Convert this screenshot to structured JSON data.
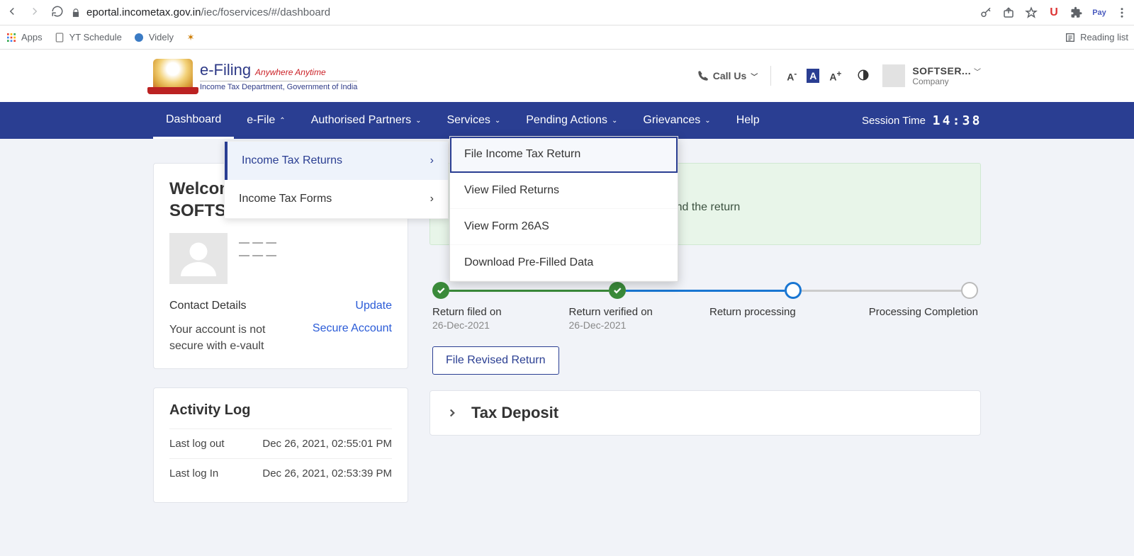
{
  "browser": {
    "url_host": "eportal.incometax.gov.in",
    "url_path": "/iec/foservices/#/dashboard",
    "bookmarks": {
      "apps": "Apps",
      "yt": "YT Schedule",
      "videly": "Videly"
    },
    "reading_list": "Reading list"
  },
  "header": {
    "brand": "e-Filing",
    "tagline": "Anywhere Anytime",
    "dept": "Income Tax Department, Government of India",
    "callus": "Call Us",
    "user_name": "SOFTSER...",
    "user_type": "Company"
  },
  "nav": {
    "items": [
      "Dashboard",
      "e-File",
      "Authorised Partners",
      "Services",
      "Pending Actions",
      "Grievances",
      "Help"
    ],
    "session_label": "Session Time",
    "session_digits": [
      "1",
      "4",
      ":",
      "3",
      "8"
    ]
  },
  "dropdown_efile": {
    "items": [
      "Income Tax Returns",
      "Income Tax Forms"
    ]
  },
  "dropdown_itr": {
    "items": [
      "File Income Tax Return",
      "View Filed Returns",
      "View Form 26AS",
      "Download Pre-Filled Data"
    ]
  },
  "profile": {
    "welcome_prefix": "Welcome B",
    "company_line": "SOFTSERV",
    "contact_label": "Contact Details",
    "update_link": "Update",
    "secure_msg": "Your account is not secure with e-vault",
    "secure_link": "Secure Account"
  },
  "activity": {
    "title": "Activity Log",
    "rows": [
      {
        "label": "Last log out",
        "value": "Dec 26, 2021, 02:55:01 PM"
      },
      {
        "label": "Last log In",
        "value": "Dec 26, 2021, 02:53:39 PM"
      }
    ]
  },
  "notice": "…sure it is completed at the earliest. Please find the return",
  "steps": {
    "labels": [
      {
        "title": "Return filed on",
        "sub": "26-Dec-2021"
      },
      {
        "title": "Return verified on",
        "sub": "26-Dec-2021"
      },
      {
        "title": "Return processing",
        "sub": ""
      },
      {
        "title": "Processing Completion",
        "sub": ""
      }
    ],
    "file_revised": "File Revised Return"
  },
  "accordion": {
    "tax_deposit": "Tax Deposit"
  }
}
